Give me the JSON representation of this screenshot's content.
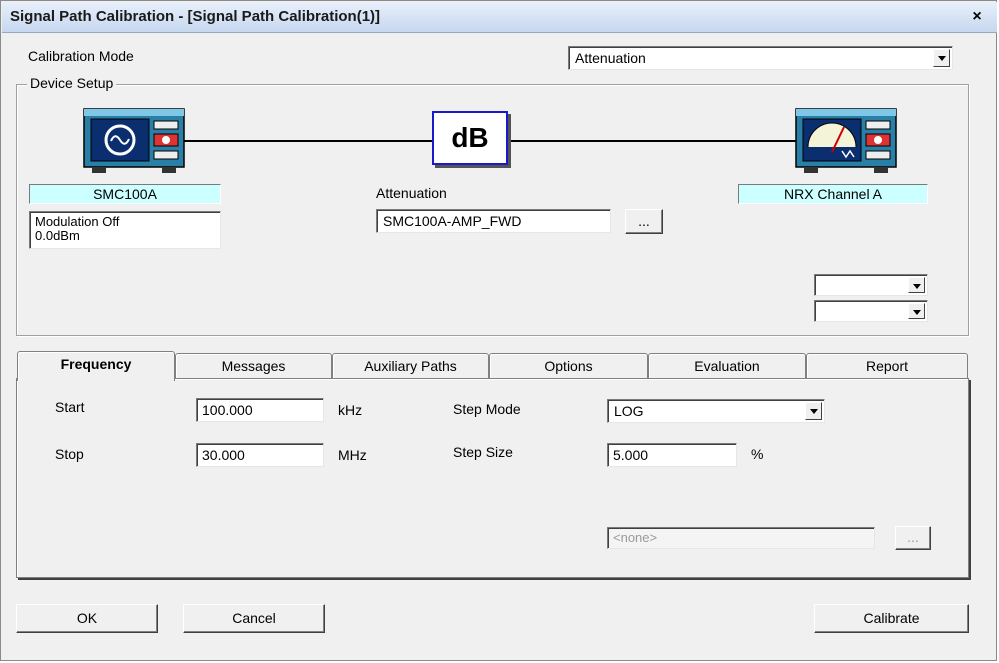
{
  "window": {
    "title": "Signal Path Calibration - [Signal Path Calibration(1)]",
    "close_glyph": "×"
  },
  "calibration_mode": {
    "label": "Calibration Mode",
    "value": "Attenuation"
  },
  "device_setup": {
    "title": "Device Setup",
    "source": {
      "name": "SMC100A",
      "status_line1": "Modulation Off",
      "status_line2": "0.0dBm",
      "icon": "signal-generator-icon"
    },
    "attenuator": {
      "glyph": "dB",
      "label": "Attenuation",
      "value": "SMC100A-AMP_FWD",
      "browse_label": "..."
    },
    "sensor": {
      "name": "NRX Channel A",
      "icon": "power-meter-icon"
    },
    "extra_combo_1": "",
    "extra_combo_2": ""
  },
  "tabs": [
    {
      "label": "Frequency",
      "active": true
    },
    {
      "label": "Messages",
      "active": false
    },
    {
      "label": "Auxiliary Paths",
      "active": false
    },
    {
      "label": "Options",
      "active": false
    },
    {
      "label": "Evaluation",
      "active": false
    },
    {
      "label": "Report",
      "active": false
    }
  ],
  "frequency": {
    "start_label": "Start",
    "start_value": "100.000",
    "start_unit": "kHz",
    "stop_label": "Stop",
    "stop_value": "30.000",
    "stop_unit": "MHz",
    "step_mode_label": "Step Mode",
    "step_mode_value": "LOG",
    "step_size_label": "Step Size",
    "step_size_value": "5.000",
    "step_size_unit": "%",
    "none_field": "<none>",
    "none_browse_label": "..."
  },
  "buttons": {
    "ok": "OK",
    "cancel": "Cancel",
    "calibrate": "Calibrate"
  },
  "colors": {
    "device_label_bg": "#ccffff",
    "instrument_body": "#1e6b8a",
    "instrument_screen": "#0a2a6a"
  }
}
